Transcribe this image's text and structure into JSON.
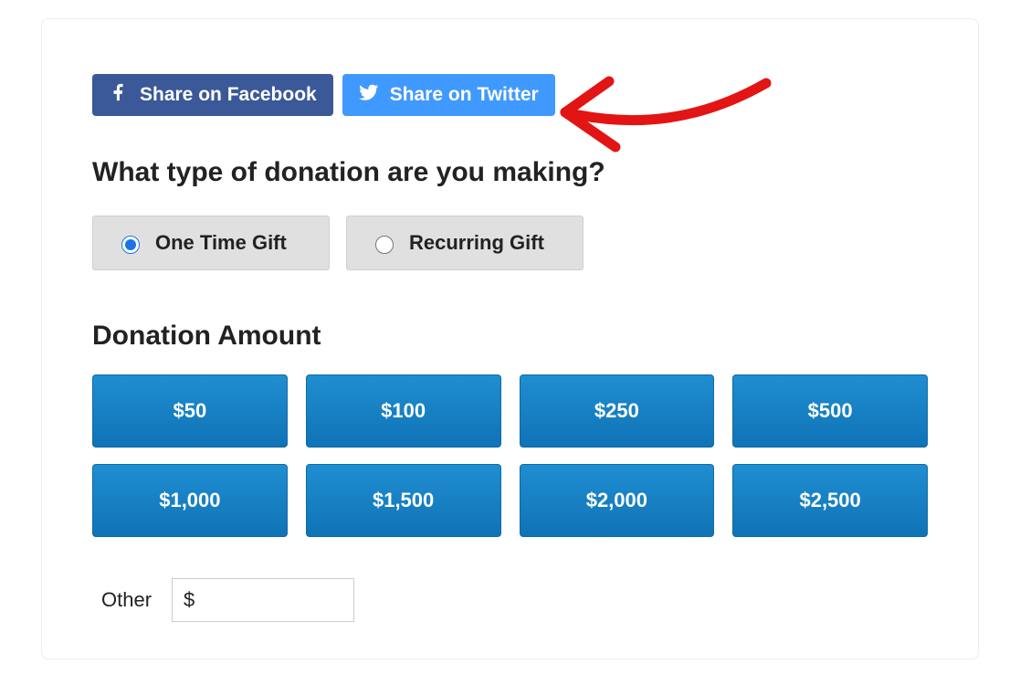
{
  "share": {
    "facebook_label": "Share on Facebook",
    "twitter_label": "Share on Twitter"
  },
  "question": {
    "heading": "What type of donation are you making?",
    "options": {
      "one_time": "One Time Gift",
      "recurring": "Recurring Gift"
    },
    "selected": "one_time"
  },
  "amount": {
    "heading": "Donation Amount",
    "buttons": [
      "$50",
      "$100",
      "$250",
      "$500",
      "$1,000",
      "$1,500",
      "$2,000",
      "$2,500"
    ],
    "other": {
      "label": "Other",
      "currency": "$",
      "value": ""
    }
  }
}
